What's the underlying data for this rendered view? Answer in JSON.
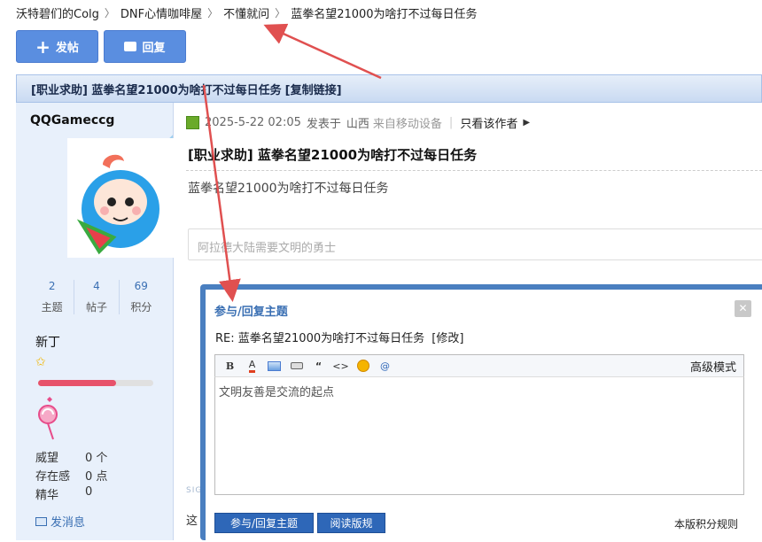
{
  "breadcrumb": [
    "沃特碧们的Colg",
    "DNF心情咖啡屋",
    "不懂就问",
    "蓝拳名望21000为啥打不过每日任务"
  ],
  "toolbar": {
    "post_label": "发帖",
    "reply_label": "回复"
  },
  "topic": {
    "title": "[职业求助] 蓝拳名望21000为啥打不过每日任务",
    "copy_link": "[复制链接]"
  },
  "author": {
    "name": "QQGameccg",
    "stats": [
      {
        "value": "2",
        "label": "主题"
      },
      {
        "value": "4",
        "label": "帖子"
      },
      {
        "value": "69",
        "label": "积分"
      }
    ],
    "rank": "新丁",
    "star": "✩",
    "progress": 0.68,
    "info": [
      {
        "key": "威望",
        "value": "0 个"
      },
      {
        "key": "存在感",
        "value": "0 点"
      },
      {
        "key": "精华",
        "value": "0"
      }
    ],
    "send_message": "发消息"
  },
  "post": {
    "date": "2025-5-22 02:05",
    "posted_in": "发表于",
    "location": "山西",
    "device": "来自移动设备",
    "author_only": "只看该作者",
    "title": "[职业求助] 蓝拳名望21000为啥打不过每日任务",
    "body": "蓝拳名望21000为啥打不过每日任务",
    "quick_reply_placeholder": "阿拉德大陆需要文明的勇士",
    "sig_text": "SIG",
    "footer_text": "这"
  },
  "modal": {
    "title": "参与/回复主题",
    "subject": "RE: 蓝拳名望21000为啥打不过每日任务",
    "edit_link": "[修改]",
    "toolbar_icons": [
      "bold-icon",
      "font-color-icon",
      "image-icon",
      "attachment-icon",
      "quote-icon",
      "code-icon",
      "emoji-icon",
      "at-icon"
    ],
    "advanced_mode": "高级模式",
    "textarea_placeholder": "文明友善是交流的起点",
    "submit_label": "参与/回复主题",
    "rules_label": "阅读版规",
    "points_rules": "本版积分规则"
  },
  "colors": {
    "accent": "#5a8ee0",
    "arrow": "#e05050",
    "modal_border": "#4a7fc0",
    "topic_bar": "#c9daf2"
  }
}
